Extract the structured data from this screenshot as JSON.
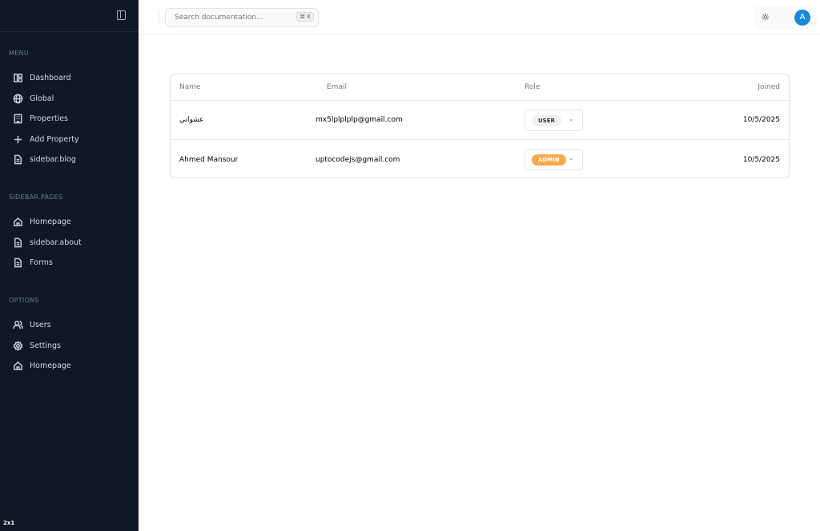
{
  "sidebar": {
    "sections": [
      {
        "title": "MENU",
        "items": [
          {
            "label": "Dashboard",
            "icon": "dashboard-icon"
          },
          {
            "label": "Global",
            "icon": "globe-icon"
          },
          {
            "label": "Properties",
            "icon": "building-icon"
          },
          {
            "label": "Add Property",
            "icon": "plus-icon"
          },
          {
            "label": "sidebar.blog",
            "icon": "file-icon"
          }
        ]
      },
      {
        "title": "SIDEBAR.PAGES",
        "items": [
          {
            "label": "Homepage",
            "icon": "home-icon"
          },
          {
            "label": "sidebar.about",
            "icon": "file-icon"
          },
          {
            "label": "Forms",
            "icon": "file-icon"
          }
        ]
      },
      {
        "title": "OPTIONS",
        "items": [
          {
            "label": "Users",
            "icon": "users-icon"
          },
          {
            "label": "Settings",
            "icon": "gear-icon"
          },
          {
            "label": "Homepage",
            "icon": "home-icon"
          }
        ]
      }
    ],
    "badge": "2x1"
  },
  "header": {
    "search_placeholder": "Search documentation...",
    "shortcut": "⌘ K",
    "avatar": "A"
  },
  "table": {
    "columns": [
      "Name",
      "Email",
      "Role",
      "Joined"
    ],
    "rows": [
      {
        "name": "عشواني",
        "email": "mx5lplplplp@gmail.com",
        "role": "USER",
        "joined": "10/5/2025"
      },
      {
        "name": "Ahmed Mansour",
        "email": "uptocodejs@gmail.com",
        "role": "ADMIN",
        "joined": "10/5/2025"
      }
    ]
  },
  "colors": {
    "sidebar": "#101828",
    "admin": "#fba94c",
    "user": "#f1f1f1",
    "avatar": "#1a88d8"
  }
}
